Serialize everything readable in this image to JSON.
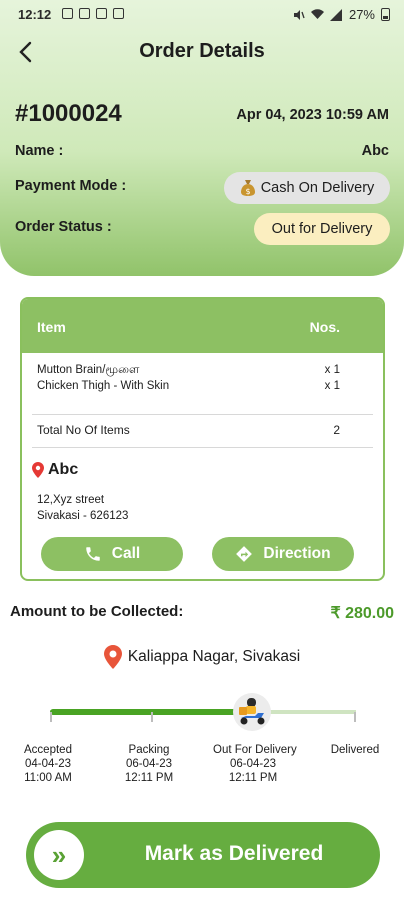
{
  "status_bar": {
    "time": "12:12",
    "battery": "27%"
  },
  "header": {
    "title": "Order Details",
    "back_icon": "chevron-left-icon"
  },
  "order": {
    "id": "#1000024",
    "date": "Apr 04, 2023 10:59 AM",
    "name_label": "Name :",
    "name_value": "Abc",
    "payment_label": "Payment Mode :",
    "payment_value": "Cash On Delivery",
    "status_label": "Order Status :",
    "status_value": "Out for Delivery"
  },
  "items_table": {
    "header_item": "Item",
    "header_nos": "Nos.",
    "rows": [
      {
        "name": "Mutton Brain/மூளை",
        "qty": "x 1"
      },
      {
        "name": "Chicken Thigh - With Skin",
        "qty": "x 1"
      }
    ],
    "total_label": "Total No Of Items",
    "total_value": "2"
  },
  "customer": {
    "name": "Abc",
    "address_line1": "12,Xyz street",
    "address_line2": "Sivakasi - 626123"
  },
  "actions": {
    "call_label": "Call",
    "direction_label": "Direction"
  },
  "amount": {
    "label": "Amount to be Collected:",
    "value": "₹ 280.00"
  },
  "location": {
    "text": "Kaliappa Nagar, Sivakasi"
  },
  "progress": {
    "fraction_complete": 0.667,
    "stages": [
      {
        "name": "Accepted",
        "date": "04-04-23",
        "time": "11:00 AM"
      },
      {
        "name": "Packing",
        "date": "06-04-23",
        "time": "12:11 PM"
      },
      {
        "name": "Out For Delivery",
        "date": "06-04-23",
        "time": "12:11 PM"
      },
      {
        "name": "Delivered",
        "date": "",
        "time": ""
      }
    ]
  },
  "mark_delivered": {
    "label": "Mark as Delivered",
    "icon_glyph": "»"
  },
  "colors": {
    "accent": "#8dc063",
    "primary_button": "#66ad40",
    "amount": "#4c9a2a",
    "status_pill": "#fbeec0"
  }
}
